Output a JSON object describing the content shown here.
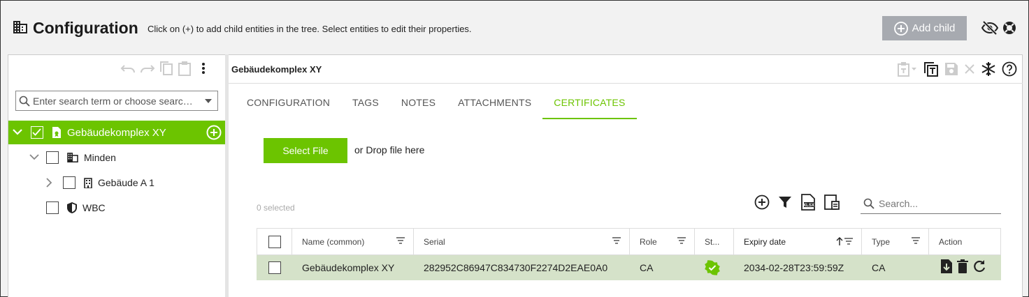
{
  "header": {
    "title": "Configuration",
    "description": "Click on (+) to add child entities in the tree. Select entities to edit their properties.",
    "add_child_label": "Add child"
  },
  "left_panel": {
    "search_placeholder": "Enter search term or choose searc…",
    "tree": [
      {
        "label": "Gebäudekomplex XY",
        "selected": true,
        "checked": true,
        "icon": "building-cert-icon",
        "level": 0,
        "expanded": true
      },
      {
        "label": "Minden",
        "selected": false,
        "checked": false,
        "icon": "building-icon",
        "level": 1,
        "expanded": true
      },
      {
        "label": "Gebäude A 1",
        "selected": false,
        "checked": false,
        "icon": "office-building-icon",
        "level": 2,
        "expanded": false
      },
      {
        "label": "WBC",
        "selected": false,
        "checked": false,
        "icon": "shield-icon",
        "level": 1
      }
    ]
  },
  "right_panel": {
    "title": "Gebäudekomplex XY",
    "tabs": [
      {
        "label": "CONFIGURATION",
        "active": false
      },
      {
        "label": "TAGS",
        "active": false
      },
      {
        "label": "NOTES",
        "active": false
      },
      {
        "label": "ATTACHMENTS",
        "active": false
      },
      {
        "label": "CERTIFICATES",
        "active": true
      }
    ],
    "select_file_label": "Select File",
    "drop_text": "or Drop file here",
    "selected_count": "0 selected",
    "search_placeholder": "Search...",
    "table": {
      "columns": [
        "Name (common)",
        "Serial",
        "Role",
        "St...",
        "Expiry date",
        "Type",
        "Action"
      ],
      "rows": [
        {
          "name": "Gebäudekomplex XY",
          "serial": "282952C86947C834730F2274D2EAE0A0",
          "role": "CA",
          "status": "valid",
          "expiry": "2034-02-28T23:59:59Z",
          "type": "CA"
        }
      ]
    }
  },
  "colors": {
    "accent": "#6cc400",
    "row_selected": "#d5e2c9",
    "button_disabled": "#a7aab0"
  }
}
